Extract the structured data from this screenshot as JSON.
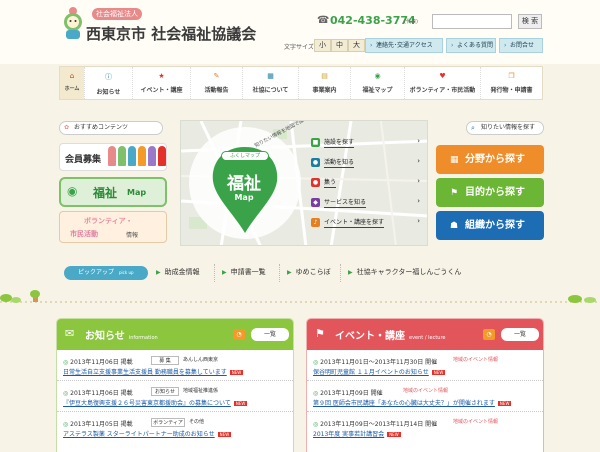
{
  "header": {
    "org_subtitle": "社会福祉法人",
    "org_title": "西東京市 社会福祉協議会",
    "phone": "042-438-3774",
    "phone_note": "(代表)",
    "search_placeholder": "",
    "search_button": "検 索",
    "font_size_label": "文字サイズ",
    "font_sizes": [
      "小",
      "中",
      "大"
    ],
    "links": [
      "連絡先･交通アクセス",
      "よくある質問",
      "お問合せ"
    ]
  },
  "nav": [
    {
      "label": "ホーム",
      "icon": "home-icon"
    },
    {
      "label": "お知らせ",
      "icon": "info-icon"
    },
    {
      "label": "イベント・講座",
      "icon": "star-icon"
    },
    {
      "label": "活動報告",
      "icon": "pencil-icon"
    },
    {
      "label": "社協について",
      "icon": "building-icon"
    },
    {
      "label": "事業案内",
      "icon": "clipboard-icon"
    },
    {
      "label": "福祉マップ",
      "icon": "map-pin-icon"
    },
    {
      "label": "ボランティア・市民活動",
      "icon": "heart-icon"
    },
    {
      "label": "発行物・申請書",
      "icon": "document-icon"
    }
  ],
  "left": {
    "recommend_label": "おすすめコンテンツ",
    "member_label": "会員募集",
    "map_banner": "福祉",
    "map_banner_sub": "Map",
    "vol_line1": "ボランティア・",
    "vol_line2": "市民活動",
    "vol_line3": "情報"
  },
  "map": {
    "title": "福祉",
    "sub": "Map",
    "badge": "ふくしマップ",
    "arc": "知りたい情報を地図で探そう！",
    "menu": [
      {
        "label": "施設を探す",
        "color": "#3aa34a",
        "icon": "building-icon"
      },
      {
        "label": "活動を知る",
        "color": "#1a7ea2",
        "icon": "people-icon"
      },
      {
        "label": "集う",
        "color": "#e4322b",
        "icon": "users-icon"
      },
      {
        "label": "サービスを知る",
        "color": "#7a3ea2",
        "icon": "shield-icon"
      },
      {
        "label": "イベント・講座を探す",
        "color": "#e67e22",
        "icon": "music-icon"
      }
    ]
  },
  "search": {
    "info_label": "知りたい情報を探す",
    "buttons": [
      {
        "label": "分野から探す",
        "color": "#ef8d2a"
      },
      {
        "label": "目的から探す",
        "color": "#6bb634"
      },
      {
        "label": "組織から探す",
        "color": "#1d6db5"
      }
    ]
  },
  "pickup": {
    "badge": "ピックアップ",
    "badge_sub": "pick up",
    "items": [
      "助成金情報",
      "申請書一覧",
      "ゆめこらぼ",
      "社協キャラクター福しんごうくん"
    ]
  },
  "news": {
    "title": "お知らせ",
    "sub": "information",
    "list_button": "一覧",
    "items": [
      {
        "date": "2013年11月06日 掲載",
        "cat1": "募 集",
        "cat2": "あんしん西東京",
        "link": "日常生活自立支援事業生活支援員 勤務職員を募集しています",
        "new": "NEW"
      },
      {
        "date": "2013年11月06日 掲載",
        "cat1": "お知らせ",
        "cat2": "地域福祉推進係",
        "link": "『伊豆大島復興支援２６号災害東京都援助会』の募集について",
        "new": "NEW"
      },
      {
        "date": "2013年11月05日 掲載",
        "cat1": "ボランティア",
        "cat2": "その他",
        "link": "アステラス製薬 スターライトパートナー助成のお知らせ",
        "new": "NEW"
      }
    ]
  },
  "events": {
    "title": "イベント・講座",
    "sub": "event / lecture",
    "list_button": "一覧",
    "items": [
      {
        "date": "2013年11月01日～2013年11月30日 開催",
        "cat": "地域のイベント情報",
        "link": "保谷明町児童館 １１月イベントのお知らせ",
        "new": "NEW"
      },
      {
        "date": "2013年11月09日 開催",
        "cat": "地域のイベント情報",
        "link": "第９回 医師会市民講座「あなたの心臓は大丈夫？」が開催されます",
        "new": "NEW"
      },
      {
        "date": "2013年11月09日～2013年11月14日 開催",
        "cat": "地域のイベント情報",
        "link": "2013年度 実事若計講習会",
        "new": "NEW"
      }
    ]
  },
  "colors": {
    "green": "#8cc63f",
    "red": "#e2555b",
    "accent": "#3aa34a"
  }
}
